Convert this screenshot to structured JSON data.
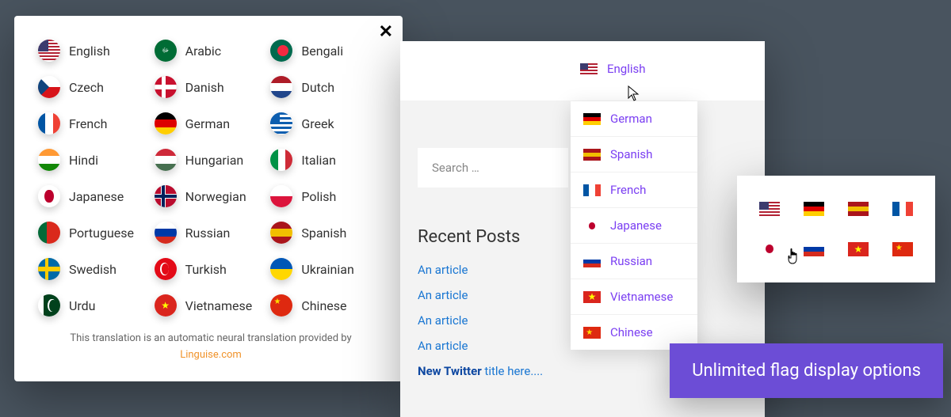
{
  "modal": {
    "close": "✕",
    "languages": [
      {
        "label": "English",
        "flag": "us"
      },
      {
        "label": "Arabic",
        "flag": "sa"
      },
      {
        "label": "Bengali",
        "flag": "bd"
      },
      {
        "label": "Czech",
        "flag": "cz"
      },
      {
        "label": "Danish",
        "flag": "dk"
      },
      {
        "label": "Dutch",
        "flag": "nl"
      },
      {
        "label": "French",
        "flag": "fr"
      },
      {
        "label": "German",
        "flag": "de"
      },
      {
        "label": "Greek",
        "flag": "gr"
      },
      {
        "label": "Hindi",
        "flag": "in"
      },
      {
        "label": "Hungarian",
        "flag": "hu"
      },
      {
        "label": "Italian",
        "flag": "it"
      },
      {
        "label": "Japanese",
        "flag": "jp"
      },
      {
        "label": "Norwegian",
        "flag": "no"
      },
      {
        "label": "Polish",
        "flag": "pl"
      },
      {
        "label": "Portuguese",
        "flag": "pt"
      },
      {
        "label": "Russian",
        "flag": "ru"
      },
      {
        "label": "Spanish",
        "flag": "es"
      },
      {
        "label": "Swedish",
        "flag": "se"
      },
      {
        "label": "Turkish",
        "flag": "tr"
      },
      {
        "label": "Ukrainian",
        "flag": "ua"
      },
      {
        "label": "Urdu",
        "flag": "pk"
      },
      {
        "label": "Vietnamese",
        "flag": "vn"
      },
      {
        "label": "Chinese",
        "flag": "cn"
      }
    ],
    "disclaimer_text": "This translation is an automatic neural translation provided by",
    "disclaimer_link": "Linguise.com"
  },
  "site": {
    "search_placeholder": "Search …",
    "recent_title": "Recent Posts",
    "posts": [
      {
        "text": "An article",
        "bold": ""
      },
      {
        "text": "An article",
        "bold": ""
      },
      {
        "text": "An article",
        "bold": ""
      },
      {
        "text": "An article",
        "bold": ""
      },
      {
        "text": " title here....",
        "bold": "New Twitter"
      }
    ]
  },
  "dropdown": {
    "current": {
      "label": "English",
      "flag": "us"
    },
    "items": [
      {
        "label": "German",
        "flag": "de"
      },
      {
        "label": "Spanish",
        "flag": "es"
      },
      {
        "label": "French",
        "flag": "fr"
      },
      {
        "label": "Japanese",
        "flag": "jp"
      },
      {
        "label": "Russian",
        "flag": "ru"
      },
      {
        "label": "Vietnamese",
        "flag": "vn"
      },
      {
        "label": "Chinese",
        "flag": "cn"
      }
    ]
  },
  "flag_grid": [
    "us",
    "de",
    "es",
    "fr",
    "jp",
    "ru",
    "vn",
    "cn"
  ],
  "banner": "Unlimited flag display options"
}
